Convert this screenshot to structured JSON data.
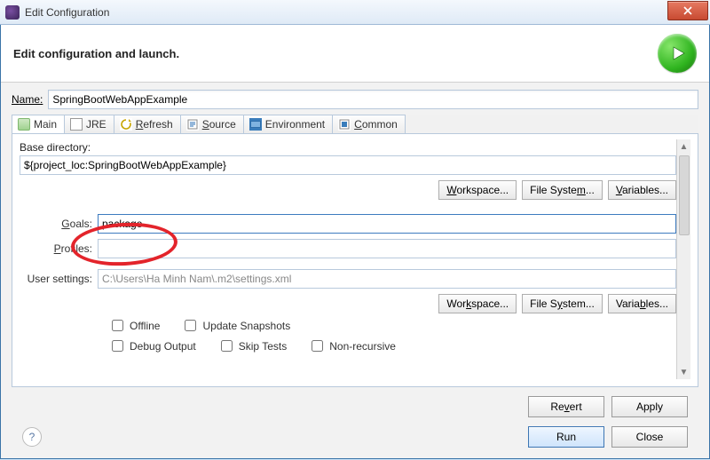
{
  "window": {
    "title": "Edit Configuration"
  },
  "header": {
    "text": "Edit configuration and launch."
  },
  "name": {
    "label_prefix": "N",
    "label_rest": "ame:",
    "value": "SpringBootWebAppExample"
  },
  "tabs": {
    "main": {
      "label": "Main"
    },
    "jre": {
      "label": "JRE"
    },
    "refresh": {
      "mn": "R",
      "rest": "efresh"
    },
    "source": {
      "mn": "S",
      "rest": "ource"
    },
    "environment": {
      "label": "Environment"
    },
    "common": {
      "mn": "C",
      "rest": "ommon"
    }
  },
  "main_tab": {
    "base_dir_label": "Base directory:",
    "base_dir_value": "${project_loc:SpringBootWebAppExample}",
    "buttons": {
      "workspace": {
        "mn": "W",
        "rest": "orkspace..."
      },
      "filesystem": {
        "pre": "File Syste",
        "mn": "m",
        "post": "..."
      },
      "variables": {
        "mn": "V",
        "rest": "ariables..."
      },
      "workspace2": {
        "pre": "Wor",
        "mn": "k",
        "post": "space..."
      },
      "filesystem2": {
        "pre": "File S",
        "mn": "y",
        "post": "stem..."
      },
      "variables2": {
        "pre": "Varia",
        "mn": "b",
        "post": "les..."
      }
    },
    "goals": {
      "label_mn": "G",
      "label_rest": "oals:",
      "value": "package"
    },
    "profiles": {
      "label_mn": "P",
      "label_rest": "rofiles:",
      "value": ""
    },
    "user_settings": {
      "label": "User settings:",
      "placeholder": "C:\\Users\\Ha Minh Nam\\.m2\\settings.xml"
    },
    "checks": {
      "offline": {
        "mn": "O",
        "rest": "ffline"
      },
      "update_snap": {
        "mn": "U",
        "rest": "pdate Snapshots"
      },
      "debug_output": {
        "mn": "D",
        "rest": "ebug Output"
      },
      "skip_tests": {
        "pre": "Skip ",
        "mn": "T",
        "post": "ests"
      },
      "non_recursive": {
        "mn": "N",
        "rest": "on-recursive"
      }
    }
  },
  "footer": {
    "revert": {
      "pre": "Re",
      "mn": "v",
      "post": "ert"
    },
    "apply": {
      "label": "Apply"
    },
    "run": {
      "label": "Run"
    },
    "close": {
      "label": "Close"
    }
  }
}
